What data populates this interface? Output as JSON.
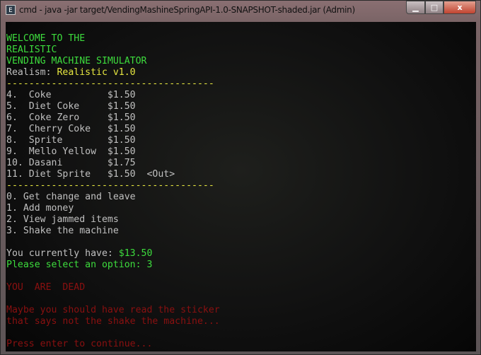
{
  "window": {
    "title": "cmd - java  -jar target/VendingMashineSpringAPI-1.0-SNAPSHOT-shaded.jar (Admin)",
    "minimize": "▁",
    "maximize": "□",
    "close": "x"
  },
  "console": {
    "header": [
      "WELCOME TO THE",
      "REALISTIC",
      "VENDING MACHINE SIMULATOR"
    ],
    "realism_label": "Realism: ",
    "realism_value": "Realistic v1.0",
    "divider": "-------------------------------------",
    "items": [
      "4.  Coke          $1.50",
      "5.  Diet Coke     $1.50",
      "6.  Coke Zero     $1.50",
      "7.  Cherry Coke   $1.50",
      "8.  Sprite        $1.50",
      "9.  Mello Yellow  $1.50",
      "10. Dasani        $1.75",
      "11. Diet Sprite   $1.50  <Out>"
    ],
    "options": [
      "0. Get change and leave",
      "1. Add money",
      "2. View jammed items",
      "3. Shake the machine"
    ],
    "balance_label": "You currently have: ",
    "balance_value": "$13.50",
    "prompt": "Please select an option: 3",
    "dead": "YOU  ARE  DEAD",
    "message": [
      "Maybe you should have read the sticker",
      "that says not the shake the machine..."
    ],
    "continue": "Press enter to continue..."
  }
}
